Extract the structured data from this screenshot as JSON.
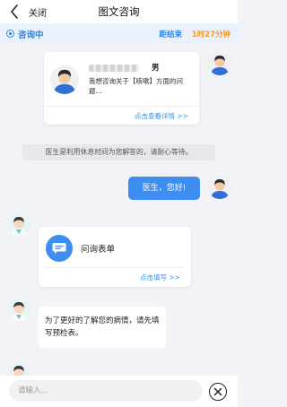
{
  "header": {
    "back_icon": "chevron-left-icon",
    "close_label": "关闭",
    "title": "图文咨询"
  },
  "status": {
    "state_label": "咨询中",
    "remain_label": "距结束",
    "remain_time": "1时27分钟",
    "colors": {
      "accent": "#2f83e4",
      "time": "#f29a2e"
    }
  },
  "messages": {
    "patient_card": {
      "gender": "男",
      "description": "我想咨询关于【咳嗽】方面的问题...",
      "link": "点击查看详情 >>"
    },
    "system_notice": "医生是利用休息时间为您解答的，请耐心等待。",
    "user_greeting": "医生，您好!",
    "form_card": {
      "title": "问询表单",
      "icon": "chat-form-icon",
      "link": "点击填写 >>"
    },
    "doctor_prompt": "为了更好的了解您的病情，请先填写预检表。"
  },
  "input": {
    "placeholder": "请输入...",
    "close_icon": "close-circle-icon"
  }
}
